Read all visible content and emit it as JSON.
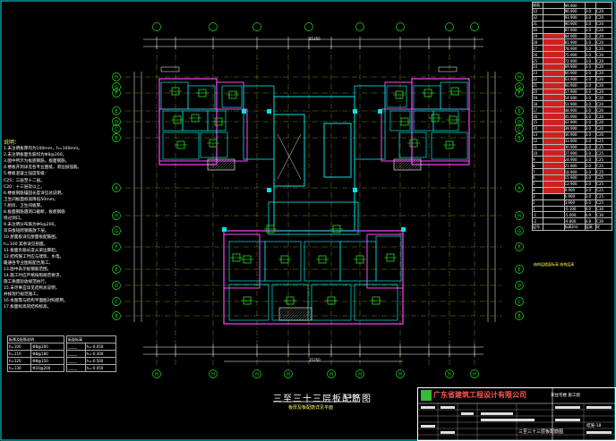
{
  "drawing": {
    "title": "三至三十三层板配筋图",
    "scale": "1:100",
    "subtitle": "板厚及板配筋详见平面",
    "total_dim": "35350"
  },
  "notes": {
    "header": "说明：",
    "lines": [
      "1.未注明板厚均为100mm，h=100mm。",
      "2.未注明板面负筋均为Φ8@200。",
      "3.图中所示为板底钢筋，板面钢筋。",
      "4.楼板开洞详见各专业图纸，洞边加强筋。",
      "5.楼板混凝土强度等级：",
      "  C25：三层至十二层。",
      "  C20：十三层及以上。",
      "6.楼板钢筋锚固长度详见总说明。",
      "  卫生间板面标高降低50mm。",
      "7.厨房、卫生间板厚。",
      "8.板面钢筋遇洞口截断，板底钢筋",
      "  绕过洞口。",
      "9.未注明分布筋为Φ6@200。",
      "  双向板短跨钢筋放下层。",
      "10.屋面板详见屋面板配筋图。",
      "  h=100 其余详见剖面。",
      "11.板面负筋长度从梁边算起。",
      "12.结构施工时应与建筑、水电。",
      "  暖通各专业图纸配合施工。",
      "13.图中表示板钢筋范围。",
      "14.施工时应严格按照规范要求，",
      "  施工质量验收规范执行。",
      "15.未尽事宜详见结构总说明，",
      "  并按现行规范施工。",
      "16.本图需与结构平面图对照使用。",
      "17.板面标高同结构标高。"
    ]
  },
  "legend_left": {
    "header": "板厚及配筋说明",
    "rows": [
      [
        "h=100",
        "Φ8@200"
      ],
      [
        "h=110",
        "Φ8@180"
      ],
      [
        "h=120",
        "Φ8@150"
      ],
      [
        "h=130",
        "Φ10@200"
      ]
    ]
  },
  "legend_right": {
    "header": "板面标高",
    "rows": [
      [
        "_____",
        "h=-0.050"
      ],
      [
        "_____",
        "h=-0.300"
      ],
      [
        "_____",
        "h=-0.500"
      ],
      [
        "_____",
        "h=-0.050"
      ]
    ]
  },
  "level_table": {
    "rows": [
      [
        "屋面",
        "",
        "99.900",
        "",
        ""
      ],
      [
        "33",
        "",
        "96.900",
        "3.0",
        "C20"
      ],
      [
        "32",
        "",
        "93.900",
        "3.0",
        "C20"
      ],
      [
        "31",
        "",
        "90.900",
        "3.0",
        "C20"
      ],
      [
        "30",
        "",
        "87.900",
        "3.0",
        "C20"
      ],
      [
        "29",
        "",
        "84.900",
        "3.0",
        "C20"
      ],
      [
        "28",
        "",
        "81.900",
        "3.0",
        "C20"
      ],
      [
        "27",
        "",
        "78.900",
        "3.0",
        "C20"
      ],
      [
        "26",
        "",
        "75.900",
        "3.0",
        "C20"
      ],
      [
        "25",
        "",
        "72.900",
        "3.0",
        "C20"
      ],
      [
        "24",
        "",
        "69.900",
        "3.0",
        "C20"
      ],
      [
        "23",
        "",
        "66.900",
        "3.0",
        "C20"
      ],
      [
        "22",
        "",
        "63.900",
        "3.0",
        "C20"
      ],
      [
        "21",
        "",
        "60.900",
        "3.0",
        "C20"
      ],
      [
        "20",
        "",
        "57.900",
        "3.0",
        "C20"
      ],
      [
        "19",
        "",
        "54.900",
        "3.0",
        "C20"
      ],
      [
        "18",
        "",
        "51.900",
        "3.0",
        "C20"
      ],
      [
        "17",
        "",
        "48.900",
        "3.0",
        "C20"
      ],
      [
        "16",
        "",
        "45.900",
        "3.0",
        "C20"
      ],
      [
        "15",
        "",
        "42.900",
        "3.0",
        "C20"
      ],
      [
        "14",
        "",
        "39.900",
        "3.0",
        "C20"
      ],
      [
        "13",
        "",
        "36.900",
        "3.0",
        "C20"
      ],
      [
        "12",
        "",
        "33.900",
        "3.0",
        "C25"
      ],
      [
        "11",
        "",
        "30.900",
        "3.0",
        "C25"
      ],
      [
        "10",
        "",
        "27.900",
        "3.0",
        "C25"
      ],
      [
        "9",
        "",
        "24.900",
        "3.0",
        "C25"
      ],
      [
        "8",
        "",
        "21.900",
        "3.0",
        "C25"
      ],
      [
        "7",
        "",
        "18.900",
        "3.0",
        "C25"
      ],
      [
        "6",
        "",
        "15.900",
        "3.0",
        "C25"
      ],
      [
        "5",
        "",
        "12.900",
        "3.0",
        "C25"
      ],
      [
        "4",
        "",
        "9.900",
        "3.0",
        "C25"
      ],
      [
        "3",
        "",
        "6.900",
        "3.0",
        "C25"
      ],
      [
        "2",
        "",
        "3.900",
        "3.0",
        "C25"
      ],
      [
        "1",
        "",
        "-0.100",
        "4.0",
        "C30"
      ],
      [
        "-1",
        "",
        "-5.000",
        "4.9",
        "C30"
      ],
      [
        "-2",
        "",
        "-9.800",
        "4.8",
        "C30"
      ],
      [
        "层号",
        "",
        "标高(m)",
        "层高",
        "砼"
      ]
    ],
    "footer": "结构层楼面标高 结构层高"
  },
  "title_block": {
    "company": "广东省建筑工程设计有限公司",
    "project": "某住宅楼 施工图",
    "drawing_name": "三至三十三层板配筋图",
    "sheet_no": "结施-18"
  },
  "axis_labels": {
    "rows_left": [
      "H",
      "G",
      "F",
      "E",
      "D",
      "C",
      "B",
      "A",
      "H",
      "G",
      "F",
      "E",
      "D",
      "C",
      "B"
    ],
    "bottom": [
      "H",
      "H",
      "H",
      "H",
      "H",
      "H",
      "H",
      "H",
      "H",
      "H"
    ]
  },
  "colors": {
    "background": "#000000",
    "wall": "#00e5e5",
    "slab": "#ff44ff",
    "green": "#22dd22",
    "dim": "#ffffff",
    "grid": "#dddd44",
    "highlight": "#cc2020"
  }
}
